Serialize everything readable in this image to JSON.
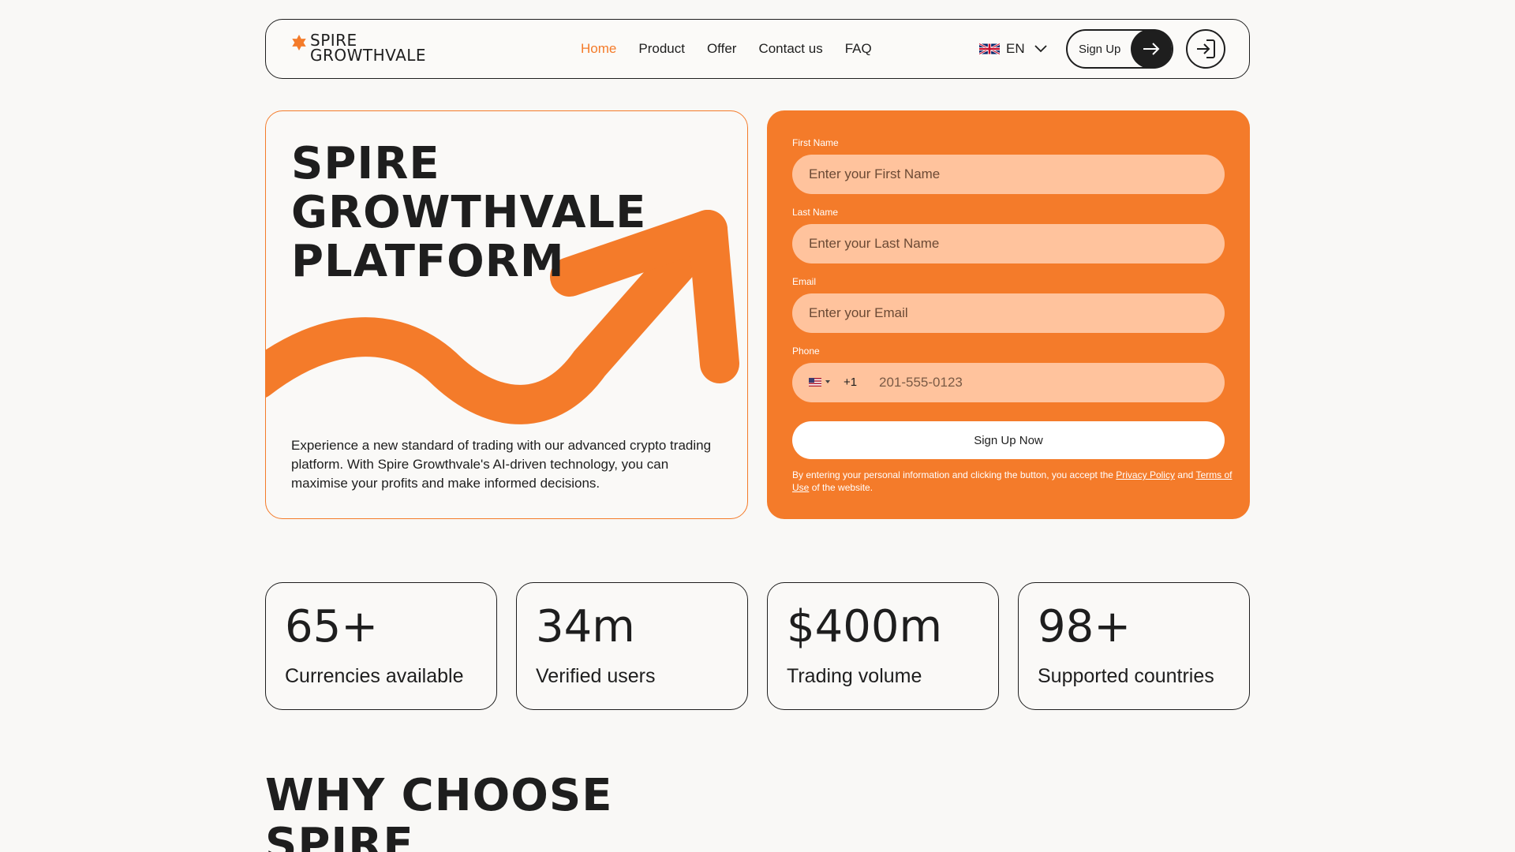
{
  "header": {
    "logo_line1": "SPIRE",
    "logo_line2": "GROWTHVALE",
    "nav": [
      "Home",
      "Product",
      "Offer",
      "Contact us",
      "FAQ"
    ],
    "active_nav": "Home",
    "language": "EN",
    "signup_label": "Sign Up",
    "login_icon": "login-icon"
  },
  "hero": {
    "title_lines": [
      "SPIRE",
      "GROWTHVALE",
      "PLATFORM"
    ],
    "description": "Experience a new standard of trading with our advanced crypto trading platform. With Spire Growthvale's AI-driven technology, you can maximise your profits and make informed decisions."
  },
  "form": {
    "first_name_label": "First Name",
    "first_name_placeholder": "Enter your First Name",
    "last_name_label": "Last Name",
    "last_name_placeholder": "Enter your Last Name",
    "email_label": "Email",
    "email_placeholder": "Enter your Email",
    "phone_label": "Phone",
    "phone_code": "+1",
    "phone_placeholder": "201-555-0123",
    "submit_label": "Sign Up Now",
    "consent_prefix": "By entering your personal information and clicking the button, you accept the",
    "privacy_link": "Privacy Policy",
    "consent_and": "and",
    "terms_link": "Terms of Use",
    "consent_suffix": "of the website."
  },
  "stats": [
    {
      "value": "65+",
      "label": "Currencies available"
    },
    {
      "value": "34m",
      "label": "Verified users"
    },
    {
      "value": "$400m",
      "label": "Trading volume"
    },
    {
      "value": "98+",
      "label": "Supported countries"
    }
  ],
  "why": {
    "title_lines": [
      "WHY CHOOSE",
      "SPIRE"
    ]
  },
  "colors": {
    "accent": "#f47b2a",
    "input_bg": "#ffc39d",
    "dark": "#1e1e1e",
    "page_bg": "#f9f8f6"
  }
}
